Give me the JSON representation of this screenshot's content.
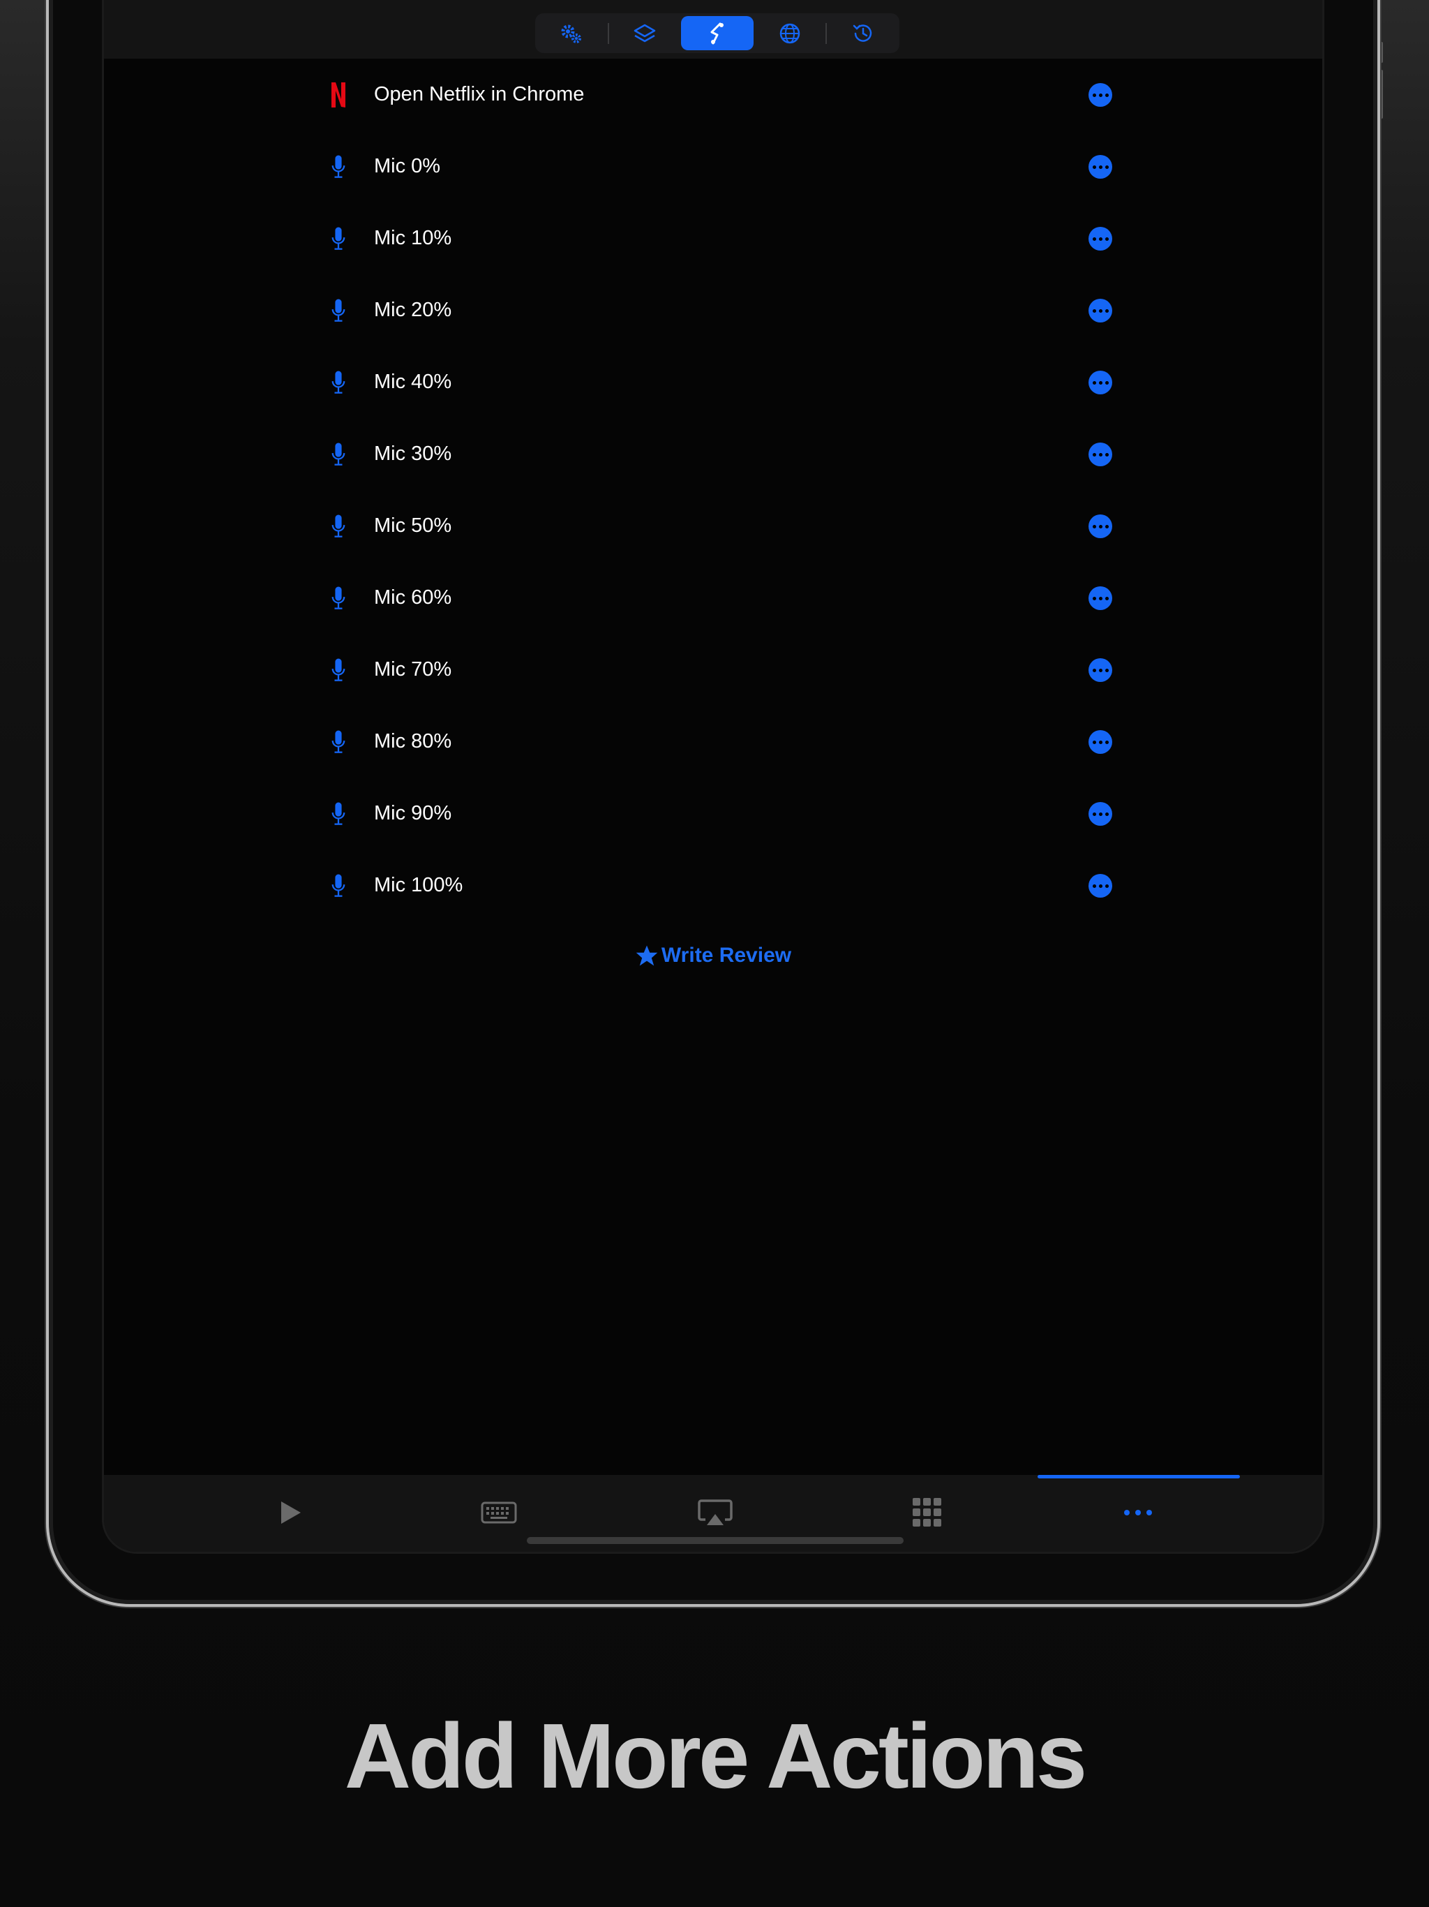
{
  "colors": {
    "accent": "#1566f5",
    "netflix": "#e50914",
    "caption": "#c7c7c7"
  },
  "toolbar": {
    "segments": [
      {
        "icon": "gears-icon"
      },
      {
        "icon": "layers-icon"
      },
      {
        "icon": "shortcut-icon",
        "active": true
      },
      {
        "icon": "globe-icon"
      },
      {
        "icon": "history-icon"
      }
    ]
  },
  "actions": [
    {
      "label": "Open Netflix in Chrome",
      "icon": "netflix-icon"
    },
    {
      "label": "Mic 0%",
      "icon": "mic-icon"
    },
    {
      "label": "Mic 10%",
      "icon": "mic-icon"
    },
    {
      "label": "Mic 20%",
      "icon": "mic-icon"
    },
    {
      "label": "Mic 40%",
      "icon": "mic-icon"
    },
    {
      "label": "Mic 30%",
      "icon": "mic-icon"
    },
    {
      "label": "Mic 50%",
      "icon": "mic-icon"
    },
    {
      "label": "Mic 60%",
      "icon": "mic-icon"
    },
    {
      "label": "Mic 70%",
      "icon": "mic-icon"
    },
    {
      "label": "Mic 80%",
      "icon": "mic-icon"
    },
    {
      "label": "Mic 90%",
      "icon": "mic-icon"
    },
    {
      "label": "Mic 100%",
      "icon": "mic-icon"
    }
  ],
  "review": {
    "label": "Write Review",
    "icon": "star-icon"
  },
  "tabbar": {
    "tabs": [
      {
        "icon": "play-icon"
      },
      {
        "icon": "keyboard-icon"
      },
      {
        "icon": "airplay-icon"
      },
      {
        "icon": "grid-icon"
      },
      {
        "icon": "more-icon",
        "active": true
      }
    ]
  },
  "caption": "Add More Actions"
}
